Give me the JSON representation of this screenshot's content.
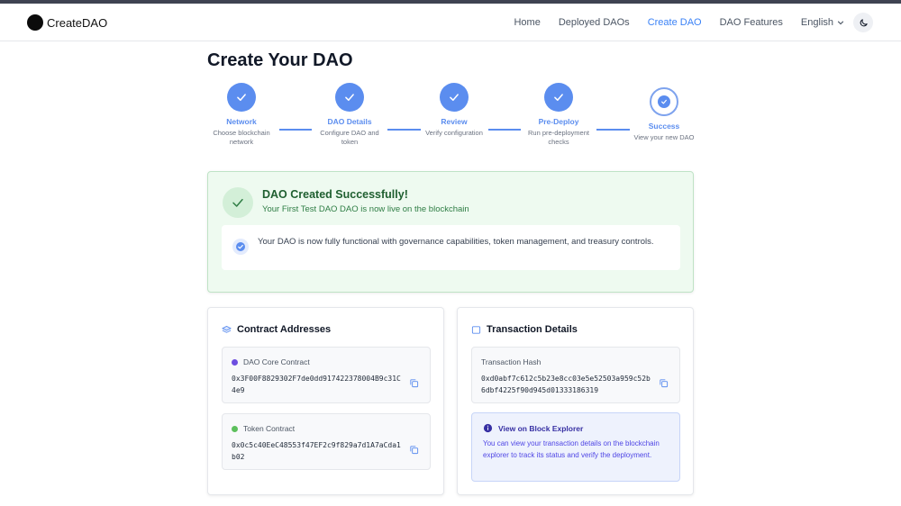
{
  "brand": {
    "name": "CreateDAO"
  },
  "nav": {
    "links": [
      "Home",
      "Deployed DAOs",
      "Create DAO",
      "DAO Features"
    ],
    "active": "Create DAO",
    "language": "English"
  },
  "page": {
    "title": "Create Your DAO"
  },
  "steps": [
    {
      "label": "Network",
      "desc": "Choose blockchain network",
      "status": "done"
    },
    {
      "label": "DAO Details",
      "desc": "Configure DAO and token",
      "status": "done"
    },
    {
      "label": "Review",
      "desc": "Verify configuration",
      "status": "done"
    },
    {
      "label": "Pre-Deploy",
      "desc": "Run pre-deployment checks",
      "status": "done"
    },
    {
      "label": "Success",
      "desc": "View your new DAO",
      "status": "current"
    }
  ],
  "success": {
    "title": "DAO Created Successfully!",
    "subtitle": "Your First Test DAO DAO is now live on the blockchain",
    "info": "Your DAO is now fully functional with governance capabilities, token management, and treasury controls."
  },
  "contracts": {
    "title": "Contract Addresses",
    "dao_core": {
      "label": "DAO Core Contract",
      "address": "0x3F00F8829302F7de0dd917422378004B9c31C4e9",
      "dot_color": "#6d4ee0"
    },
    "token": {
      "label": "Token Contract",
      "address": "0x0c5c40EeC48553f47EF2c9f829a7d1A7aCda1b02",
      "dot_color": "#5cbf5c"
    }
  },
  "transaction": {
    "title": "Transaction Details",
    "hash_label": "Transaction Hash",
    "hash": "0xd0abf7c612c5b23e8cc03e5e52503a959c52b6dbf4225f90d945d01333186319",
    "explorer_title": "View on Block Explorer",
    "explorer_text": "You can view your transaction details on the blockchain explorer to track its status and verify the deployment."
  },
  "colors": {
    "accent": "#5b8def",
    "active_nav": "#3b82f6",
    "success_bg": "#eefaf0",
    "success_text": "#1f5f30"
  }
}
